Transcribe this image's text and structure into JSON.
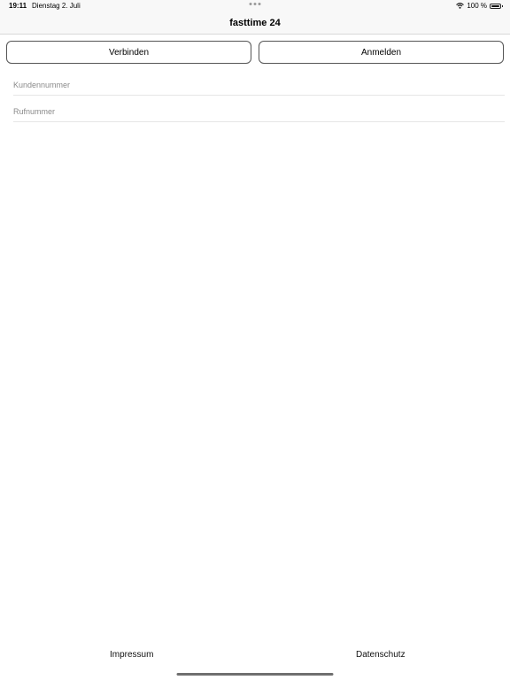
{
  "status_bar": {
    "time": "19:11",
    "date": "Dienstag 2. Juli",
    "battery_text": "100 %",
    "wifi_icon": "wifi-icon",
    "battery_icon": "battery-icon"
  },
  "nav": {
    "title": "fasttime 24"
  },
  "buttons": {
    "connect_label": "Verbinden",
    "login_label": "Anmelden"
  },
  "form": {
    "customer_number_placeholder": "Kundennummer",
    "customer_number_value": "",
    "phone_placeholder": "Rufnummer",
    "phone_value": ""
  },
  "footer": {
    "impressum_label": "Impressum",
    "privacy_label": "Datenschutz"
  }
}
